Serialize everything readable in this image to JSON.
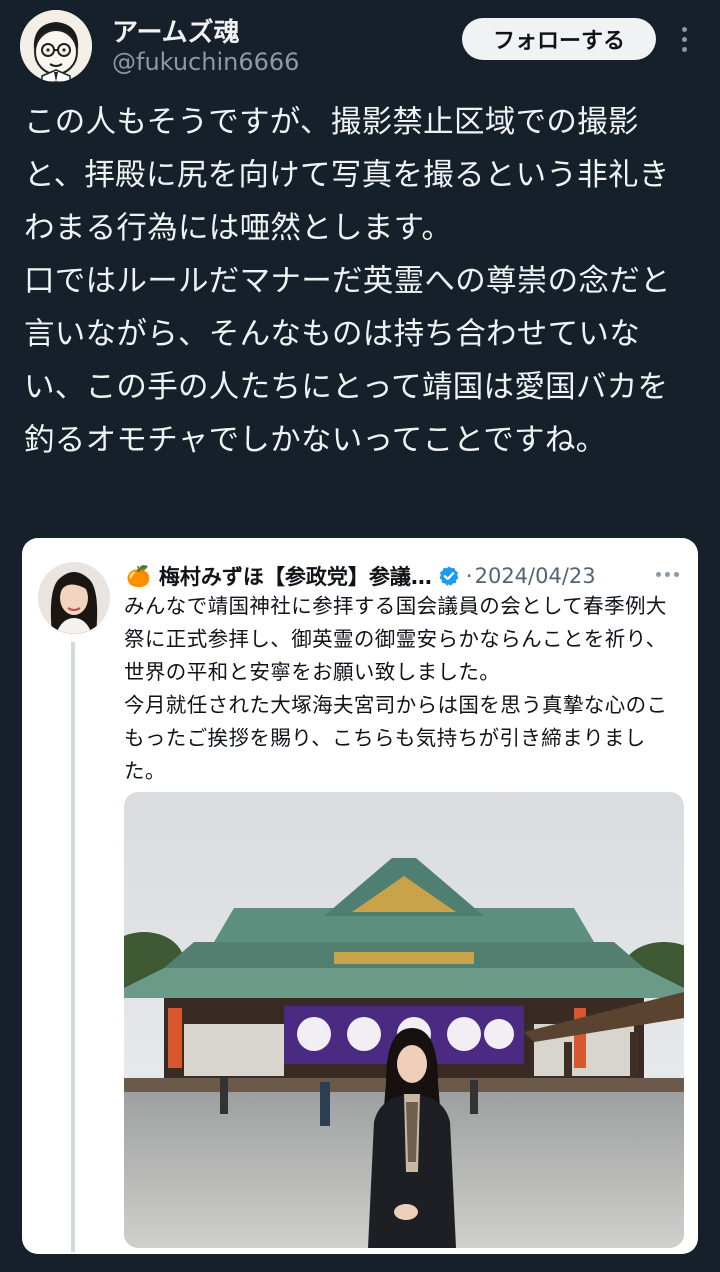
{
  "header": {
    "display_name": "アームズ魂",
    "handle": "@fukuchin6666",
    "follow_label": "フォローする"
  },
  "tweet": {
    "text": "この人もそうですが、撮影禁止区域での撮影と、拝殿に尻を向けて写真を撮るという非礼きわまる行為には唖然とします。\n口ではルールだマナーだ英霊への尊崇の念だと言いながら、そんなものは持ち合わせていない、この手の人たちにとって靖国は愛国バカを釣るオモチャでしかないってことですね。"
  },
  "quote": {
    "emoji": "🍊",
    "name": "梅村みずほ【参政党】参議…",
    "date": "2024/04/23",
    "separator": "·",
    "text": "みんなで靖国神社に参拝する国会議員の会として春季例大祭に正式参拝し、御英霊の御霊安らかならんことを祈り、世界の平和と安寧をお願い致しました。\n今月就任された大塚海夫宮司からは国を思う真摯な心のこもったご挨拶を賜り、こちらも気持ちが引き締まりました。"
  },
  "icons": {
    "avatar": "cartoon-man-avatar",
    "more": "more-vertical-icon",
    "verified": "verified-badge-icon",
    "quote_more": "more-horizontal-icon"
  },
  "colors": {
    "background": "#15202b",
    "verified": "#1d9bf0",
    "follow_bg": "#eff3f4"
  }
}
